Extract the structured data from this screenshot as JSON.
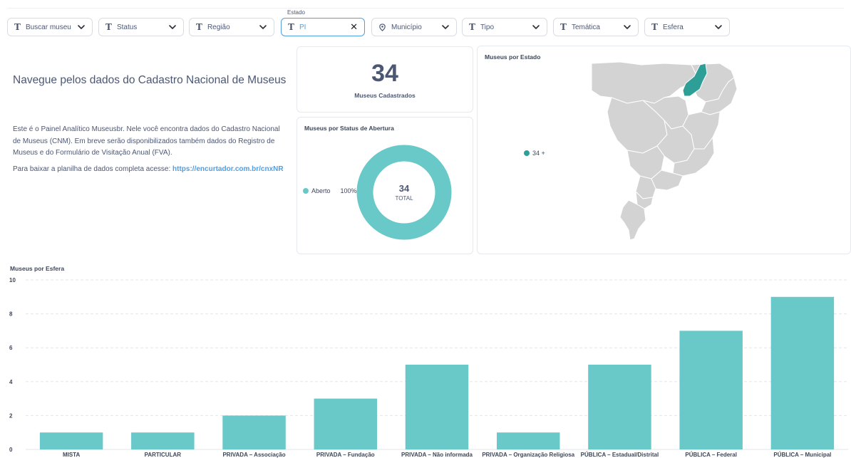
{
  "filters": [
    {
      "label": "Buscar museu",
      "icon": "text-icon"
    },
    {
      "label": "Status",
      "icon": "text-icon"
    },
    {
      "label": "Região",
      "icon": "text-icon"
    },
    {
      "label": "PI",
      "caption": "Estado",
      "icon": "text-icon",
      "active": true
    },
    {
      "label": "Município",
      "icon": "location-pin-icon"
    },
    {
      "label": "Tipo",
      "icon": "text-icon"
    },
    {
      "label": "Temática",
      "icon": "text-icon"
    },
    {
      "label": "Esfera",
      "icon": "text-icon"
    }
  ],
  "intro": {
    "title": "Navegue pelos dados do Cadastro Nacional de Museus",
    "paragraph": "Este é o Painel Analítico Museusbr. Nele você encontra dados do Cadastro Nacional de Museus (CNM). Em breve serão disponibilizados também dados do Registro de Museus e do Formulário de Visitação Anual (FVA).",
    "download_prefix": "Para baixar a planilha de dados completa acesse: ",
    "download_link": "https://encurtador.com.br/cnxNR"
  },
  "kpi": {
    "value": "34",
    "label": "Museus Cadastrados"
  },
  "status_card": {
    "title": "Museus por Status de Abertura",
    "legend_label": "Aberto",
    "legend_pct": "100%",
    "total_value": "34",
    "total_label": "TOTAL"
  },
  "map_card": {
    "title": "Museus por Estado",
    "legend": "34 +",
    "highlight_color": "#2e9f97",
    "base_color": "#d3d3d3"
  },
  "colors": {
    "accent": "#509ee3",
    "bar": "#69c8c8",
    "text": "#4c5773"
  },
  "chart_data": {
    "type": "bar",
    "title": "Museus por Esfera",
    "categories": [
      "MISTA",
      "PARTICULAR",
      "PRIVADA – Associação",
      "PRIVADA – Fundação",
      "PRIVADA – Não informada",
      "PRIVADA – Organização Religiosa",
      "PÚBLICA – Estadual/Distrital",
      "PÚBLICA – Federal",
      "PÚBLICA – Municipal"
    ],
    "values": [
      1,
      1,
      2,
      3,
      5,
      1,
      5,
      7,
      9
    ],
    "yticks": [
      0,
      2,
      4,
      6,
      8,
      10
    ],
    "ylim": [
      0,
      10
    ],
    "grid": true,
    "color": "#69c8c8"
  }
}
